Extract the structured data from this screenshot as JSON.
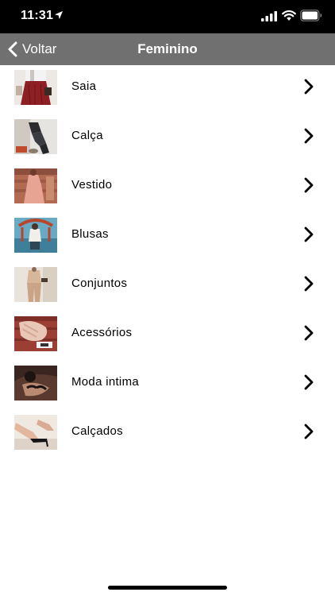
{
  "status_bar": {
    "time": "11:31",
    "icons": [
      "location-arrow-icon",
      "cellular-signal-icon",
      "wifi-icon",
      "battery-icon"
    ]
  },
  "nav": {
    "back_label": "Voltar",
    "title": "Feminino"
  },
  "categories": [
    {
      "label": "Saia",
      "image": "skirt-photo"
    },
    {
      "label": "Calça",
      "image": "pants-photo"
    },
    {
      "label": "Vestido",
      "image": "dress-photo"
    },
    {
      "label": "Blusas",
      "image": "blouse-photo"
    },
    {
      "label": "Conjuntos",
      "image": "outfit-set-photo"
    },
    {
      "label": "Acessórios",
      "image": "accessories-photo"
    },
    {
      "label": "Moda intima",
      "image": "lingerie-photo"
    },
    {
      "label": "Calçados",
      "image": "shoes-photo"
    }
  ],
  "colors": {
    "status_bar": "#000000",
    "nav_bar": "#707070",
    "background": "#ffffff",
    "text": "#000000"
  }
}
